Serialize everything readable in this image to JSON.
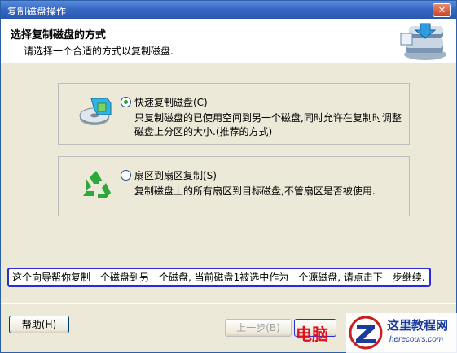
{
  "window": {
    "title": "复制磁盘操作"
  },
  "header": {
    "title": "选择复制磁盘的方式",
    "subtitle": "请选择一个合适的方式以复制磁盘."
  },
  "options": [
    {
      "label": "快速复制磁盘(C)",
      "description": "只复制磁盘的已使用空间到另一个磁盘,同时允许在复制时调整磁盘上分区的大小.(推荐的方式)",
      "selected": true,
      "icon": "disk-copy-icon"
    },
    {
      "label": "扇区到扇区复制(S)",
      "description": "复制磁盘上的所有扇区到目标磁盘,不管扇区是否被使用.",
      "selected": false,
      "icon": "recycle-icon"
    }
  ],
  "info_text": "这个向导帮你复制一个磁盘到另一个磁盘, 当前磁盘1被选中作为一个源磁盘, 请点击下一步继续.",
  "buttons": {
    "help": "帮助(H)",
    "back": "上一步(B)"
  },
  "watermark": {
    "red_text": "电脑",
    "site_name": "这里教程网",
    "site_url": "herecours.com"
  },
  "colors": {
    "title_bar": "#3668c4",
    "info_border": "#2b2bd6",
    "radio_dot": "#24a024",
    "watermark_red": "#e01020"
  }
}
